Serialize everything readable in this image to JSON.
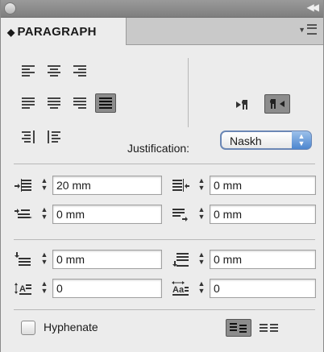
{
  "panel": {
    "title": "PARAGRAPH",
    "tab_arrows": "⬍"
  },
  "alignment_buttons": [
    {
      "name": "align-left",
      "selected": false
    },
    {
      "name": "align-center",
      "selected": false
    },
    {
      "name": "align-right",
      "selected": false
    },
    {
      "name": "justify-last-left",
      "selected": false
    },
    {
      "name": "justify-last-center",
      "selected": false
    },
    {
      "name": "justify-last-right",
      "selected": false
    },
    {
      "name": "justify-all",
      "selected": true
    },
    {
      "name": "align-towards-spine",
      "selected": false
    },
    {
      "name": "align-away-from-spine",
      "selected": false
    }
  ],
  "direction_buttons": [
    {
      "name": "left-to-right",
      "selected": false
    },
    {
      "name": "right-to-left",
      "selected": true
    }
  ],
  "justification": {
    "label": "Justification:",
    "value": "Naskh"
  },
  "fields": {
    "left_indent": "20 mm",
    "right_indent": "0 mm",
    "first_line_indent": "0 mm",
    "last_line_indent": "0 mm",
    "space_before": "0 mm",
    "space_after": "0 mm",
    "drop_cap_lines": "0",
    "drop_cap_chars": "0"
  },
  "hyphenate": {
    "label": "Hyphenate",
    "checked": false
  },
  "grid_buttons": [
    {
      "name": "do-not-align-to-grid",
      "selected": true
    },
    {
      "name": "align-to-baseline-grid",
      "selected": false
    }
  ],
  "colors": {
    "selected_button": "#8c8c8c",
    "select_focus": "#6b87b5"
  }
}
